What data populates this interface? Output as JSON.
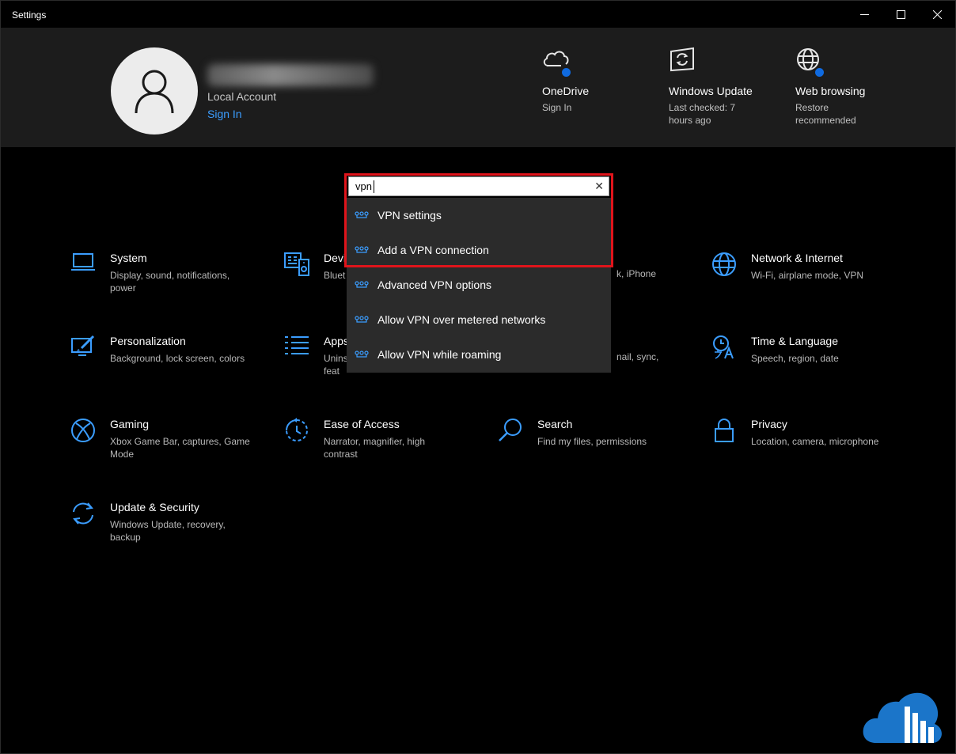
{
  "window": {
    "title": "Settings",
    "controls": {
      "minimize": "—",
      "maximize": "☐",
      "close": "✕"
    }
  },
  "account": {
    "type": "Local Account",
    "sign_in": "Sign In"
  },
  "quick_links": [
    {
      "title": "OneDrive",
      "subtitle": "Sign In"
    },
    {
      "title": "Windows Update",
      "subtitle": "Last checked: 7 hours ago"
    },
    {
      "title": "Web browsing",
      "subtitle": "Restore recommended"
    }
  ],
  "search": {
    "value": "vpn",
    "clear_icon": "✕"
  },
  "suggestions": [
    {
      "label": "VPN settings"
    },
    {
      "label": "Add a VPN connection"
    },
    {
      "label": "Advanced VPN options"
    },
    {
      "label": "Allow VPN over metered networks"
    },
    {
      "label": "Allow VPN while roaming"
    }
  ],
  "tiles": {
    "system": {
      "title": "System",
      "desc": "Display, sound, notifications, power"
    },
    "devices": {
      "title": "Devi",
      "desc": "Bluet"
    },
    "phone": {
      "desc": "k, iPhone"
    },
    "network": {
      "title": "Network & Internet",
      "desc": "Wi-Fi, airplane mode, VPN"
    },
    "personalization": {
      "title": "Personalization",
      "desc": "Background, lock screen, colors"
    },
    "apps": {
      "title": "Apps",
      "desc": "Unins feat"
    },
    "accounts": {
      "desc": "nail, sync,"
    },
    "time": {
      "title": "Time & Language",
      "desc": "Speech, region, date"
    },
    "gaming": {
      "title": "Gaming",
      "desc": "Xbox Game Bar, captures, Game Mode"
    },
    "ease": {
      "title": "Ease of Access",
      "desc": "Narrator, magnifier, high contrast"
    },
    "search": {
      "title": "Search",
      "desc": "Find my files, permissions"
    },
    "privacy": {
      "title": "Privacy",
      "desc": "Location, camera, microphone"
    },
    "update": {
      "title": "Update & Security",
      "desc": "Windows Update, recovery, backup"
    }
  },
  "colors": {
    "accent": "#3b9dff",
    "highlight": "#e0141b",
    "header_band": "#1c1c1c",
    "dropdown": "#2b2b2b"
  }
}
